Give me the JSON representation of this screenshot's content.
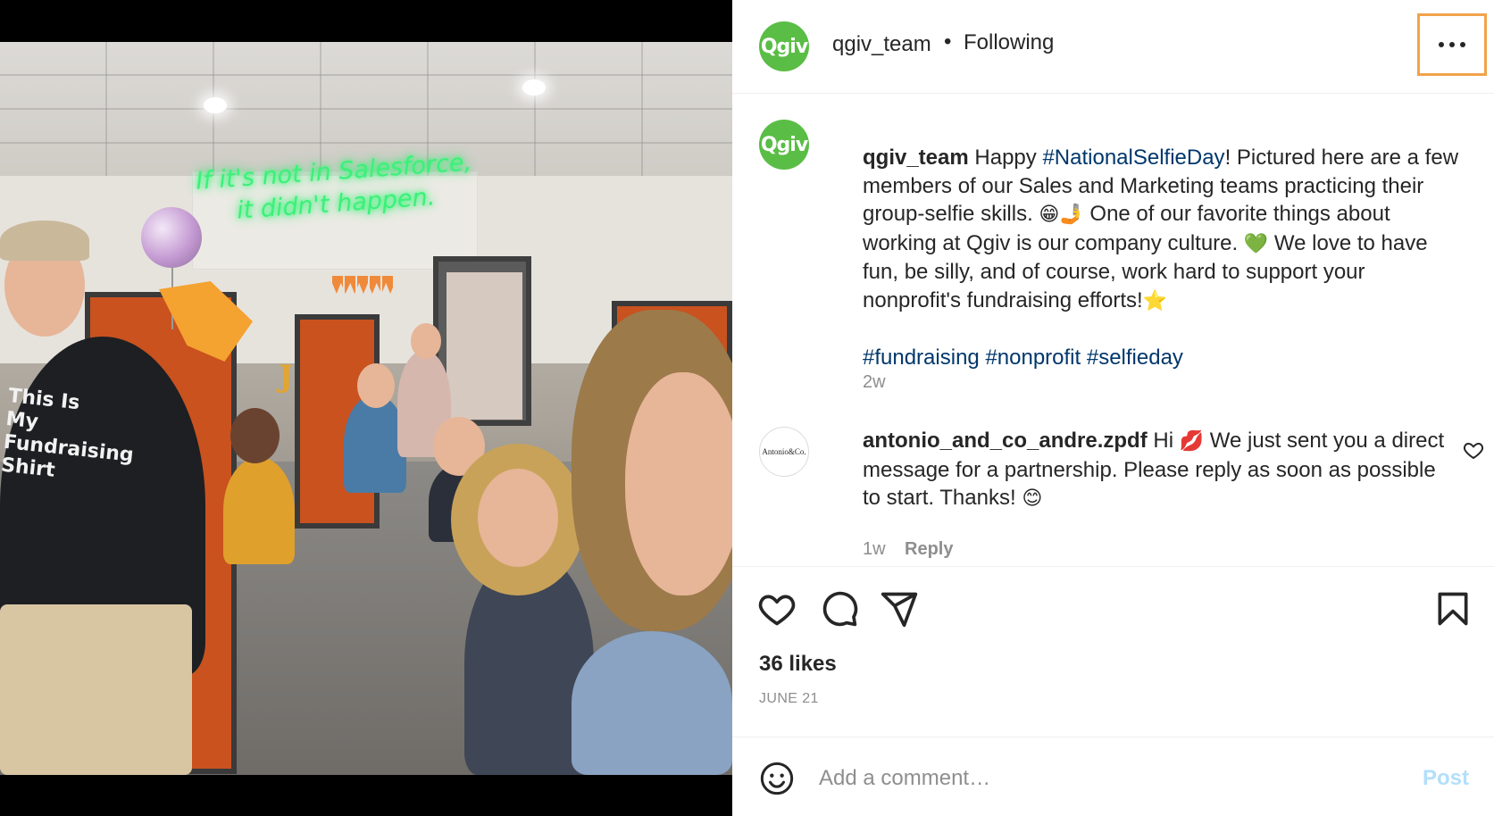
{
  "post": {
    "username": "qgiv_team",
    "follow_status": "Following",
    "avatar_text": "Qgiv",
    "photo": {
      "neon_sign_line1": "If it's not in Salesforce,",
      "neon_sign_line2": "it didn't happen.",
      "shirt_text": "This Is My Fundraising Shirt",
      "letter": "J"
    }
  },
  "caption": {
    "username": "qgiv_team",
    "text_before_tag": " Happy ",
    "tag1": "#NationalSelfieDay",
    "text_after_tag": "! Pictured here are a few members of our Sales and Marketing teams practicing their group-selfie skills. ",
    "emoji1": "😁🤳",
    "text_mid": " One of our favorite things about working at Qgiv is our company culture. ",
    "emoji2": "💚",
    "text_end": " We love to have fun, be silly, and of course, work hard to support your nonprofit's fundraising efforts!",
    "emoji3": "⭐",
    "hashtags": [
      "#fundraising",
      "#nonprofit",
      "#selfieday"
    ],
    "time": "2w"
  },
  "comments": [
    {
      "avatar_text": "Antonio&Co.",
      "username": "antonio_and_co_andre.zpdf",
      "text_start": " Hi ",
      "emoji1": "💋",
      "text_end": " We just sent you a direct message for a partnership. Please reply as soon as possible to start. Thanks! ",
      "emoji2": "😊",
      "time": "1w",
      "reply_label": "Reply"
    }
  ],
  "actions": {
    "likes": "36 likes",
    "date": "JUNE 21"
  },
  "comment_box": {
    "placeholder": "Add a comment…",
    "post_label": "Post"
  },
  "icons": [
    "more-icon",
    "heart-icon",
    "comment-icon",
    "share-icon",
    "bookmark-icon",
    "emoji-icon",
    "small-heart-icon"
  ],
  "colors": {
    "link": "#00376b",
    "post_disabled": "#b2dffc",
    "highlight_border": "#f1a34a",
    "brand_green": "#5abd45"
  }
}
